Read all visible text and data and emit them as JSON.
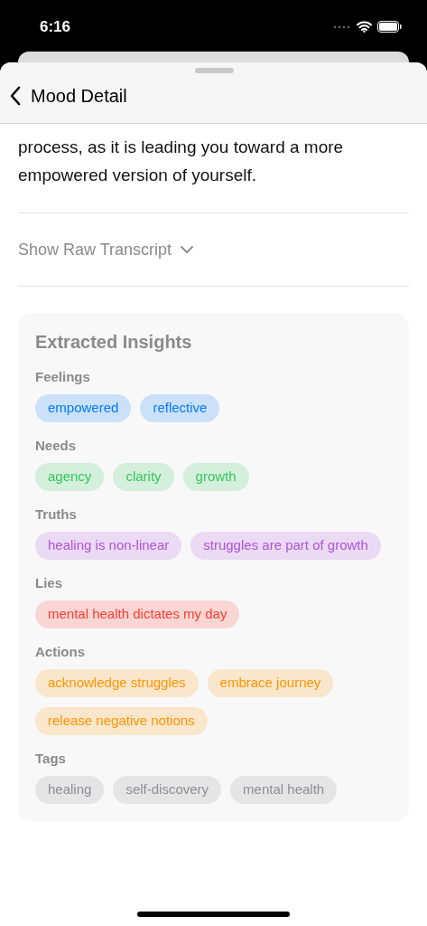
{
  "status_bar": {
    "time": "6:16"
  },
  "nav": {
    "title": "Mood Detail"
  },
  "summary": "process, as it is leading you toward a more empowered version of yourself.",
  "transcript_toggle": {
    "label": "Show Raw Transcript",
    "expanded": false
  },
  "insights": {
    "title": "Extracted Insights",
    "sections": [
      {
        "label": "Feelings",
        "color": "#007aff",
        "chips": [
          "empowered",
          "reflective"
        ]
      },
      {
        "label": "Needs",
        "color": "#34c759",
        "chips": [
          "agency",
          "clarity",
          "growth"
        ]
      },
      {
        "label": "Truths",
        "color": "#af52de",
        "chips": [
          "healing is non-linear",
          "struggles are part of growth"
        ]
      },
      {
        "label": "Lies",
        "color": "#ff3b30",
        "chips": [
          "mental health dictates my day"
        ]
      },
      {
        "label": "Actions",
        "color": "#ff9500",
        "chips": [
          "acknowledge struggles",
          "embrace journey",
          "release negative notions"
        ]
      },
      {
        "label": "Tags",
        "color": "#8e8e93",
        "chips": [
          "healing",
          "self-discovery",
          "mental health"
        ]
      }
    ]
  }
}
